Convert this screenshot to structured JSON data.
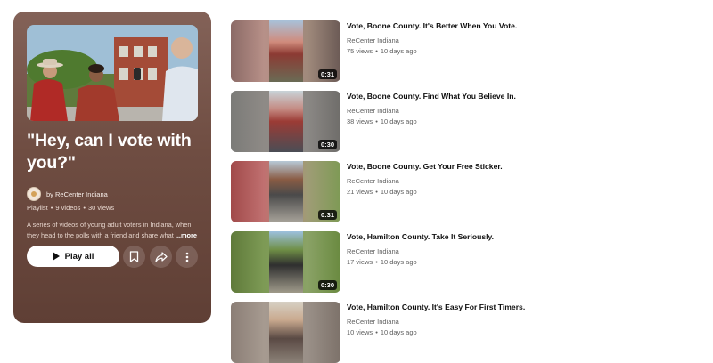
{
  "playlist": {
    "title": "\"Hey, can I vote with you?\"",
    "owner": "by ReCenter Indiana",
    "type_label": "Playlist",
    "video_count": "9 videos",
    "view_count": "30 views",
    "description": "A series of videos of young adult voters in Indiana, when they head to the polls with a friend and share what ",
    "more_label": "...more",
    "play_all_label": "Play all"
  },
  "videos": [
    {
      "title": "Vote, Boone County. It's Better When You Vote.",
      "channel": "ReCenter Indiana",
      "views": "75 views",
      "age": "10 days ago",
      "duration": "0:31"
    },
    {
      "title": "Vote, Boone County. Find What You Believe In.",
      "channel": "ReCenter Indiana",
      "views": "38 views",
      "age": "10 days ago",
      "duration": "0:30"
    },
    {
      "title": "Vote, Boone County. Get Your Free Sticker.",
      "channel": "ReCenter Indiana",
      "views": "21 views",
      "age": "10 days ago",
      "duration": "0:31"
    },
    {
      "title": "Vote, Hamilton County. Take It Seriously.",
      "channel": "ReCenter Indiana",
      "views": "17 views",
      "age": "10 days ago",
      "duration": "0:30"
    },
    {
      "title": "Vote, Hamilton County. It's Easy For First Timers.",
      "channel": "ReCenter Indiana",
      "views": "10 views",
      "age": "10 days ago",
      "duration": ""
    }
  ],
  "icons": {
    "save": "save-to-library-icon",
    "share": "share-icon",
    "more": "more-vert-icon",
    "play": "play-icon"
  },
  "colors": {
    "panel": "#6f4d42",
    "play_button": "#ffffff",
    "title_text": "#0f0f0f",
    "meta_text": "#606060"
  }
}
